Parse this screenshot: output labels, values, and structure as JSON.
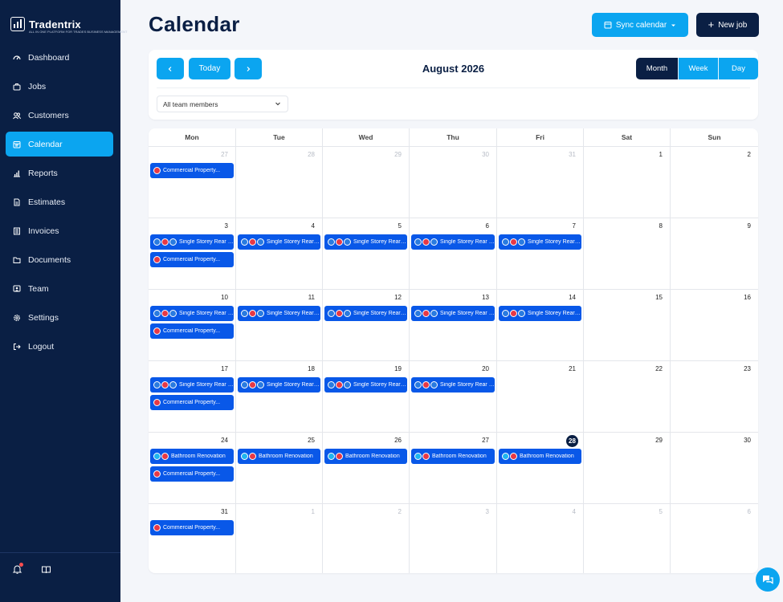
{
  "app": {
    "name": "Tradentrix",
    "tagline": "ALL IN ONE PLATFORM FOR TRADES BUSINESS MANAGEMENT"
  },
  "sidebar": {
    "items": [
      {
        "label": "Dashboard",
        "icon": "dashboard-icon",
        "active": false
      },
      {
        "label": "Jobs",
        "icon": "briefcase-icon",
        "active": false
      },
      {
        "label": "Customers",
        "icon": "users-icon",
        "active": false
      },
      {
        "label": "Calendar",
        "icon": "calendar-icon",
        "active": true
      },
      {
        "label": "Reports",
        "icon": "bar-chart-icon",
        "active": false
      },
      {
        "label": "Estimates",
        "icon": "document-icon",
        "active": false
      },
      {
        "label": "Invoices",
        "icon": "invoice-icon",
        "active": false
      },
      {
        "label": "Documents",
        "icon": "folder-icon",
        "active": false
      },
      {
        "label": "Team",
        "icon": "team-icon",
        "active": false
      },
      {
        "label": "Settings",
        "icon": "gear-icon",
        "active": false
      },
      {
        "label": "Logout",
        "icon": "logout-icon",
        "active": false
      }
    ]
  },
  "header": {
    "title": "Calendar",
    "sync_label": "Sync calendar",
    "new_job_label": "New job"
  },
  "toolbar": {
    "today_label": "Today",
    "month_label": "August 2026",
    "views": [
      "Month",
      "Week",
      "Day"
    ],
    "active_view": "Month",
    "team_filter": "All team members"
  },
  "calendar": {
    "weekdays": [
      "Mon",
      "Tue",
      "Wed",
      "Thu",
      "Fri",
      "Sat",
      "Sun"
    ],
    "today": 28,
    "days": [
      {
        "d": "27",
        "muted": true,
        "events": [
          {
            "title": "Commercial Property...",
            "badges": [
              "red"
            ]
          }
        ]
      },
      {
        "d": "28",
        "muted": true,
        "events": []
      },
      {
        "d": "29",
        "muted": true,
        "events": []
      },
      {
        "d": "30",
        "muted": true,
        "events": []
      },
      {
        "d": "31",
        "muted": true,
        "events": []
      },
      {
        "d": "1",
        "muted": false,
        "events": []
      },
      {
        "d": "2",
        "muted": false,
        "events": []
      },
      {
        "d": "3",
        "muted": false,
        "events": [
          {
            "title": "Single Storey Rear E...",
            "badges": [
              "blue",
              "red",
              "blue"
            ]
          },
          {
            "title": "Commercial Property...",
            "badges": [
              "red"
            ]
          }
        ]
      },
      {
        "d": "4",
        "muted": false,
        "events": [
          {
            "title": "Single Storey Rear E...",
            "badges": [
              "blue",
              "red",
              "blue"
            ]
          }
        ]
      },
      {
        "d": "5",
        "muted": false,
        "events": [
          {
            "title": "Single Storey Rear E...",
            "badges": [
              "blue",
              "red",
              "blue"
            ]
          }
        ]
      },
      {
        "d": "6",
        "muted": false,
        "events": [
          {
            "title": "Single Storey Rear E...",
            "badges": [
              "blue",
              "red",
              "blue"
            ]
          }
        ]
      },
      {
        "d": "7",
        "muted": false,
        "events": [
          {
            "title": "Single Storey Rear E...",
            "badges": [
              "blue",
              "red",
              "blue"
            ]
          }
        ]
      },
      {
        "d": "8",
        "muted": false,
        "events": []
      },
      {
        "d": "9",
        "muted": false,
        "events": []
      },
      {
        "d": "10",
        "muted": false,
        "events": [
          {
            "title": "Single Storey Rear E...",
            "badges": [
              "blue",
              "red",
              "blue"
            ]
          },
          {
            "title": "Commercial Property...",
            "badges": [
              "red"
            ]
          }
        ]
      },
      {
        "d": "11",
        "muted": false,
        "events": [
          {
            "title": "Single Storey Rear E...",
            "badges": [
              "blue",
              "red",
              "blue"
            ]
          }
        ]
      },
      {
        "d": "12",
        "muted": false,
        "events": [
          {
            "title": "Single Storey Rear E...",
            "badges": [
              "blue",
              "red",
              "blue"
            ]
          }
        ]
      },
      {
        "d": "13",
        "muted": false,
        "events": [
          {
            "title": "Single Storey Rear E...",
            "badges": [
              "blue",
              "red",
              "blue"
            ]
          }
        ]
      },
      {
        "d": "14",
        "muted": false,
        "events": [
          {
            "title": "Single Storey Rear E...",
            "badges": [
              "blue",
              "red",
              "blue"
            ]
          }
        ]
      },
      {
        "d": "15",
        "muted": false,
        "events": []
      },
      {
        "d": "16",
        "muted": false,
        "events": []
      },
      {
        "d": "17",
        "muted": false,
        "events": [
          {
            "title": "Single Storey Rear E...",
            "badges": [
              "blue",
              "red",
              "blue"
            ]
          },
          {
            "title": "Commercial Property...",
            "badges": [
              "red"
            ]
          }
        ]
      },
      {
        "d": "18",
        "muted": false,
        "events": [
          {
            "title": "Single Storey Rear E...",
            "badges": [
              "blue",
              "red",
              "blue"
            ]
          }
        ]
      },
      {
        "d": "19",
        "muted": false,
        "events": [
          {
            "title": "Single Storey Rear E...",
            "badges": [
              "blue",
              "red",
              "blue"
            ]
          }
        ]
      },
      {
        "d": "20",
        "muted": false,
        "events": [
          {
            "title": "Single Storey Rear E...",
            "badges": [
              "blue",
              "red",
              "blue"
            ]
          }
        ]
      },
      {
        "d": "21",
        "muted": false,
        "events": []
      },
      {
        "d": "22",
        "muted": false,
        "events": []
      },
      {
        "d": "23",
        "muted": false,
        "events": []
      },
      {
        "d": "24",
        "muted": false,
        "events": [
          {
            "title": "Bathroom Renovation",
            "badges": [
              "cyan",
              "red"
            ]
          },
          {
            "title": "Commercial Property...",
            "badges": [
              "red"
            ]
          }
        ]
      },
      {
        "d": "25",
        "muted": false,
        "events": [
          {
            "title": "Bathroom Renovation",
            "badges": [
              "cyan",
              "red"
            ]
          }
        ]
      },
      {
        "d": "26",
        "muted": false,
        "events": [
          {
            "title": "Bathroom Renovation",
            "badges": [
              "cyan",
              "red"
            ]
          }
        ]
      },
      {
        "d": "27",
        "muted": false,
        "events": [
          {
            "title": "Bathroom Renovation",
            "badges": [
              "cyan",
              "red"
            ]
          }
        ]
      },
      {
        "d": "28",
        "muted": false,
        "events": [
          {
            "title": "Bathroom Renovation",
            "badges": [
              "cyan",
              "red"
            ]
          }
        ]
      },
      {
        "d": "29",
        "muted": false,
        "events": []
      },
      {
        "d": "30",
        "muted": false,
        "events": []
      },
      {
        "d": "31",
        "muted": false,
        "events": [
          {
            "title": "Commercial Property...",
            "badges": [
              "red"
            ]
          }
        ]
      },
      {
        "d": "1",
        "muted": true,
        "events": []
      },
      {
        "d": "2",
        "muted": true,
        "events": []
      },
      {
        "d": "3",
        "muted": true,
        "events": []
      },
      {
        "d": "4",
        "muted": true,
        "events": []
      },
      {
        "d": "5",
        "muted": true,
        "events": []
      },
      {
        "d": "6",
        "muted": true,
        "events": []
      }
    ]
  },
  "colors": {
    "sidebar": "#0a1f44",
    "accent": "#0ba5f0",
    "event": "#0958e8",
    "dark": "#0a1f44"
  }
}
